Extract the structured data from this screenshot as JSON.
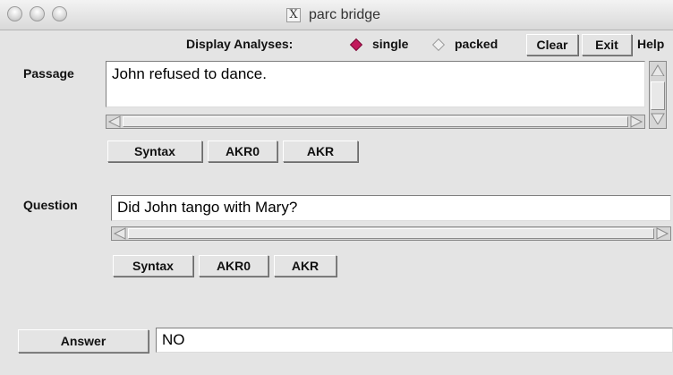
{
  "window": {
    "title": "parc bridge",
    "title_icon": "X"
  },
  "toolbar": {
    "display_label": "Display Analyses:",
    "radio_single": "single",
    "radio_packed": "packed",
    "selected": "single",
    "clear_label": "Clear",
    "exit_label": "Exit",
    "help_label": "Help"
  },
  "passage": {
    "label": "Passage",
    "text": "John refused to dance.",
    "buttons": [
      "Syntax",
      "AKR0",
      "AKR"
    ]
  },
  "question": {
    "label": "Question",
    "text": "Did John tango with Mary?",
    "buttons": [
      "Syntax",
      "AKR0",
      "AKR"
    ]
  },
  "answer": {
    "button_label": "Answer",
    "value": "NO"
  },
  "colors": {
    "radio_selected": "#c2185b",
    "window_bg": "#e4e4e4"
  }
}
